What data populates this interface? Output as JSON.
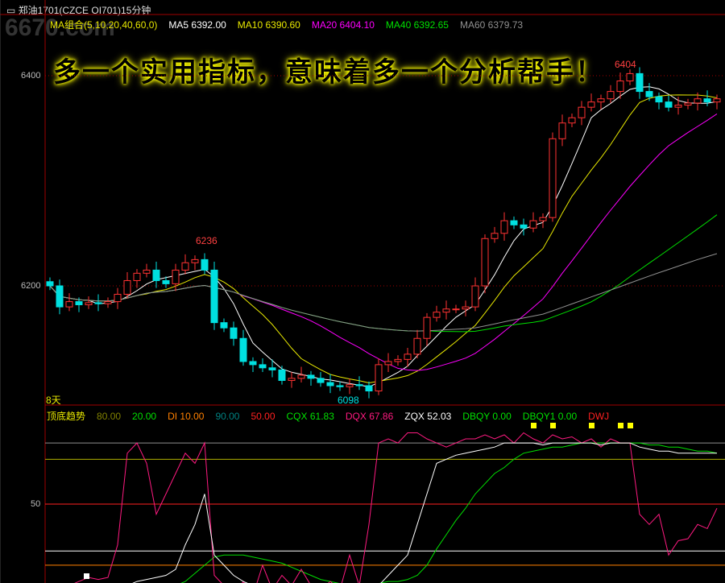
{
  "header": {
    "icon": "link-icon",
    "title": "郑油1701(CZCE OI701)15分钟"
  },
  "watermark": "6670.com",
  "ma_legend": [
    {
      "label": "MA组合(5,10,20,40,60,0)",
      "color": "#e8e800"
    },
    {
      "label": "MA5 6392.00",
      "color": "#ffffff"
    },
    {
      "label": "MA10 6390.60",
      "color": "#e8e800"
    },
    {
      "label": "MA20 6404.10",
      "color": "#ff00ff"
    },
    {
      "label": "MA40 6392.65",
      "color": "#00e000"
    },
    {
      "label": "MA60 6379.73",
      "color": "#909090"
    }
  ],
  "slogan": "多一个实用指标，意味着多一个分析帮手！",
  "price_axis": [
    "6400",
    "6200"
  ],
  "annotations": {
    "high": "6236",
    "high2": "6404",
    "low": "6098",
    "period": "8天"
  },
  "indicator_legend": [
    {
      "label": "顶底趋势",
      "color": "#e8e800"
    },
    {
      "label": "80.00",
      "color": "#808000"
    },
    {
      "label": "20.00",
      "color": "#00e000"
    },
    {
      "label": "DI  10.00",
      "color": "#ff8000"
    },
    {
      "label": "90.00",
      "color": "#008080"
    },
    {
      "label": "50.00",
      "color": "#ff2020"
    },
    {
      "label": "CQX  61.83",
      "color": "#00e000"
    },
    {
      "label": "DQX  67.86",
      "color": "#ff1a80"
    },
    {
      "label": "ZQX  52.03",
      "color": "#ffffff"
    },
    {
      "label": "DBQY  0.00",
      "color": "#00e000"
    },
    {
      "label": "DBQY1  0.00",
      "color": "#00e000"
    },
    {
      "label": "DWJ",
      "color": "#ff2020"
    }
  ],
  "indicator_axis": [
    "50"
  ],
  "chart_data": {
    "type": "candlestick",
    "price_range": [
      6080,
      6420
    ],
    "closes": [
      6200,
      6180,
      6185,
      6182,
      6184,
      6183,
      6185,
      6192,
      6205,
      6212,
      6215,
      6205,
      6202,
      6215,
      6222,
      6225,
      6215,
      6165,
      6160,
      6150,
      6128,
      6125,
      6122,
      6120,
      6110,
      6112,
      6115,
      6112,
      6108,
      6105,
      6104,
      6106,
      6105,
      6100,
      6125,
      6128,
      6130,
      6135,
      6150,
      6170,
      6175,
      6178,
      6178,
      6180,
      6200,
      6245,
      6250,
      6262,
      6258,
      6255,
      6262,
      6265,
      6340,
      6355,
      6360,
      6370,
      6375,
      6378,
      6385,
      6395,
      6402,
      6385,
      6380,
      6375,
      6370,
      6372,
      6374,
      6378,
      6375,
      6378
    ],
    "ma_periods": [
      5,
      10,
      20,
      40,
      60
    ],
    "indicator": {
      "range": [
        0,
        100
      ],
      "hlines": [
        80,
        72,
        50,
        27,
        20
      ],
      "DQX": [
        5,
        8,
        10,
        12,
        14,
        13,
        14,
        30,
        75,
        80,
        70,
        45,
        55,
        65,
        75,
        70,
        80,
        15,
        10,
        5,
        12,
        5,
        20,
        8,
        15,
        10,
        18,
        10,
        8,
        12,
        8,
        25,
        10,
        40,
        80,
        82,
        80,
        85,
        85,
        82,
        80,
        78,
        80,
        82,
        82,
        84,
        82,
        84,
        80,
        85,
        82,
        80,
        84,
        82,
        83,
        80,
        82,
        78,
        82,
        80,
        80,
        45,
        40,
        45,
        25,
        32,
        33,
        40,
        38,
        48
      ],
      "ZQX": [
        5,
        5,
        5,
        5,
        6,
        6,
        7,
        8,
        10,
        12,
        13,
        14,
        15,
        18,
        30,
        40,
        55,
        25,
        20,
        15,
        12,
        10,
        9,
        8,
        7,
        7,
        6,
        6,
        5,
        5,
        5,
        5,
        5,
        6,
        10,
        15,
        20,
        25,
        40,
        55,
        70,
        72,
        74,
        75,
        76,
        77,
        78,
        80,
        80,
        80,
        80,
        79,
        80,
        80,
        80,
        80,
        80,
        79,
        80,
        80,
        80,
        78,
        77,
        76,
        76,
        75,
        75,
        75,
        75,
        75
      ],
      "CQX": [
        8,
        6,
        4,
        3,
        3,
        4,
        4,
        5,
        5,
        6,
        7,
        8,
        9,
        10,
        12,
        16,
        20,
        24,
        25,
        25,
        25,
        24,
        23,
        22,
        21,
        19,
        17,
        15,
        13,
        12,
        11,
        10,
        10,
        10,
        11,
        12,
        12,
        13,
        15,
        20,
        28,
        35,
        42,
        48,
        55,
        60,
        65,
        68,
        72,
        75,
        76,
        77,
        78,
        78,
        79,
        80,
        80,
        80,
        80,
        80,
        80,
        80,
        79,
        79,
        78,
        78,
        77,
        76,
        76,
        75
      ],
      "DBQY_markers": [
        50,
        52,
        56,
        59,
        60
      ]
    }
  }
}
